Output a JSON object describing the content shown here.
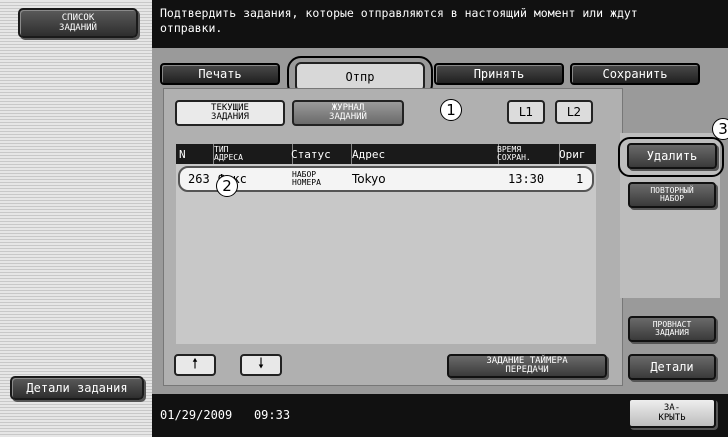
{
  "sidebar": {
    "job_list_label": "СПИСОК\nЗАДАНИЙ",
    "job_details_label": "Детали задания"
  },
  "banner": {
    "message": "Подтвердить задания, которые отправляются в настоящий момент или ждут\nотправки."
  },
  "tabs": {
    "print": "Печать",
    "send": "Отпр",
    "receive": "Принять",
    "save": "Сохранить"
  },
  "subtabs": {
    "current": "ТЕКУЩИЕ\nЗАДАНИЯ",
    "log": "ЖУРНАЛ\nЗАДАНИЙ",
    "l1": "L1",
    "l2": "L2"
  },
  "callouts": {
    "one": "1",
    "two": "2",
    "three": "3"
  },
  "table": {
    "headers": {
      "no": "N",
      "type": "ТИП\nАДРЕСА",
      "status": "Статус",
      "address": "Адрес",
      "time": "ВРЕМЯ\nСОХРАН.",
      "orig": "Ориг"
    },
    "rows": [
      {
        "no": "263",
        "type": "Факс",
        "status": "НАБОР\nНОМЕРА",
        "address": "Tokyo",
        "time": "13:30",
        "orig": "1"
      }
    ]
  },
  "buttons": {
    "delete": "Удалить",
    "redial": "ПОВТОРНЫЙ\nНАБОР",
    "timer_job": "ЗАДАНИЕ ТАЙМЕРА\nПЕРЕДАЧИ",
    "check_job": "ПРОВНАСТ\nЗАДАНИЯ",
    "details": "Детали",
    "close": "ЗА-\nКРЫТЬ"
  },
  "footer": {
    "date": "01/29/2009",
    "time": "09:33"
  }
}
